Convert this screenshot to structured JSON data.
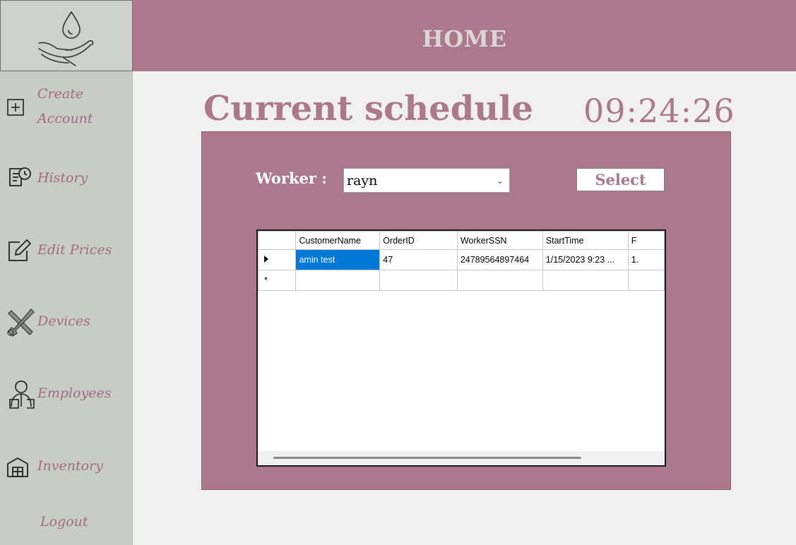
{
  "header": {
    "title": "HOME"
  },
  "sidebar": {
    "logo_icon": "water-drop-hand-icon",
    "items": [
      {
        "label_line1": "Create",
        "label_line2": "Account",
        "icon": "plus-square-icon"
      },
      {
        "label": "History",
        "icon": "clipboard-clock-icon"
      },
      {
        "label": "Edit Prices",
        "icon": "edit-square-icon"
      },
      {
        "label": "Devices",
        "icon": "tools-icon"
      },
      {
        "label": "Employees",
        "icon": "employee-icon"
      },
      {
        "label": "Inventory",
        "icon": "warehouse-icon"
      }
    ],
    "logout": "Logout"
  },
  "main": {
    "title": "Current schedule",
    "clock": "09:24:26",
    "worker_label": "Worker :",
    "worker_value": "rayn",
    "select_label": "Select"
  },
  "grid": {
    "columns": [
      "CustomerName",
      "OrderID",
      "WorkerSSN",
      "StartTime",
      "F"
    ],
    "rows": [
      [
        "amin test",
        "47",
        "24789564897464",
        "1/15/2023 9:23 ...",
        "1."
      ]
    ],
    "new_row_marker": "*"
  },
  "colors": {
    "accent": "#ab788c",
    "sidebar_bg": "#c8ccc7",
    "content_bg": "#f0f0f0",
    "selection": "#0078d7"
  }
}
